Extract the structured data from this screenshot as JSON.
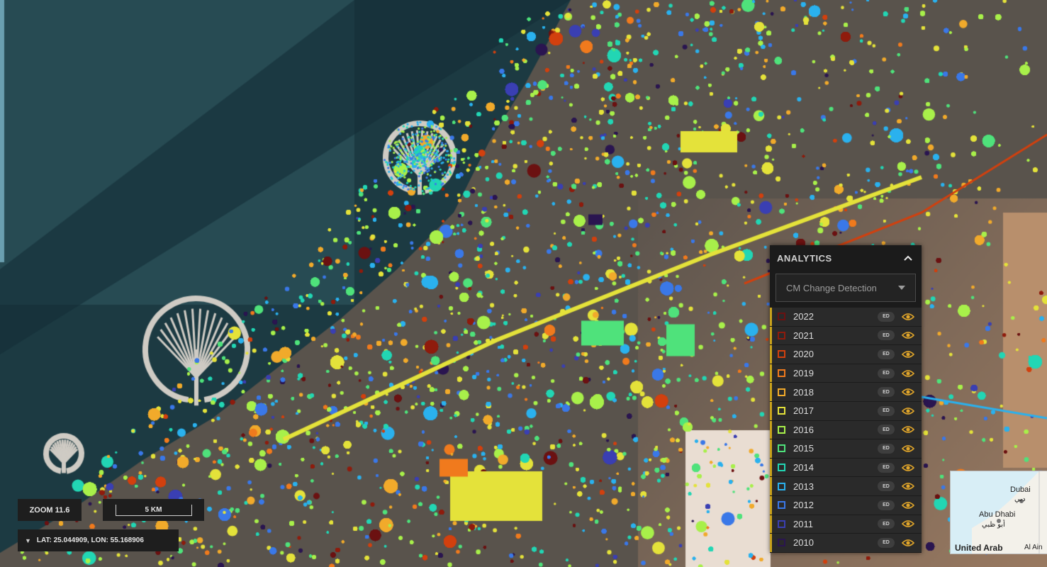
{
  "analytics": {
    "title": "ANALYTICS",
    "selector_value": "CM Change Detection",
    "badge_text": "ED",
    "accent_color": "#c9a21c",
    "eye_color": "#e0a52a",
    "layers": [
      {
        "label": "2022",
        "color": "#6b1111"
      },
      {
        "label": "2021",
        "color": "#8f1b0c"
      },
      {
        "label": "2020",
        "color": "#d2400e"
      },
      {
        "label": "2019",
        "color": "#f07a1d"
      },
      {
        "label": "2018",
        "color": "#f1aa2b"
      },
      {
        "label": "2017",
        "color": "#e4e23a"
      },
      {
        "label": "2016",
        "color": "#a8f04a"
      },
      {
        "label": "2015",
        "color": "#4fe27b"
      },
      {
        "label": "2014",
        "color": "#22d6b4"
      },
      {
        "label": "2013",
        "color": "#2ab1ee"
      },
      {
        "label": "2012",
        "color": "#3a78e8"
      },
      {
        "label": "2011",
        "color": "#3a3fb3"
      },
      {
        "label": "2010",
        "color": "#2a1550"
      }
    ]
  },
  "map_controls": {
    "zoom_label": "ZOOM 11.6",
    "scale_label": "5 KM",
    "coordinates": "LAT: 25.044909, LON: 55.168906"
  },
  "minimap": {
    "labels": [
      "Dubai",
      "دبي",
      "Abu Dhabi",
      "أبو ظبي",
      "United Arab",
      "Al Ain"
    ]
  }
}
